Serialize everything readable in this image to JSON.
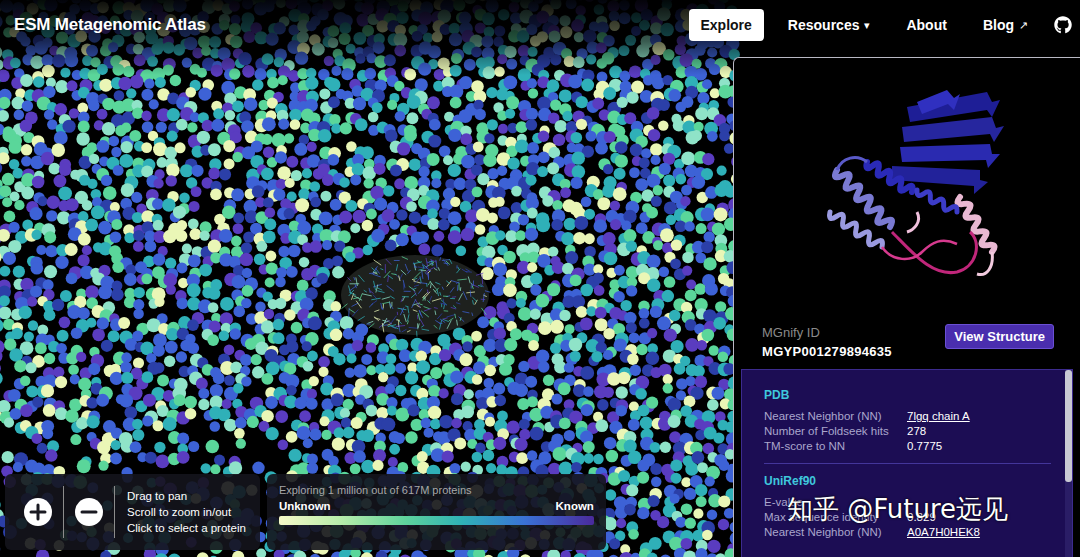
{
  "header": {
    "logo": "ESM Metagenomic Atlas",
    "nav": [
      {
        "label": "Explore",
        "selected": true
      },
      {
        "label": "Resources",
        "selected": false,
        "suffix": "▾"
      },
      {
        "label": "About",
        "selected": false
      },
      {
        "label": "Blog",
        "selected": false,
        "suffix": "↗"
      }
    ]
  },
  "map": {
    "hints": [
      "Drag to pan",
      "Scroll to zoom in/out",
      "Click to select a protein"
    ],
    "caption": "Exploring 1 million out of 617M proteins",
    "legend": {
      "low": "Unknown",
      "high": "Known"
    }
  },
  "protein": {
    "id_label": "MGnify ID",
    "id": "MGYP001279894635",
    "action": "View Structure"
  },
  "sections": [
    {
      "title": "PDB",
      "rows": [
        {
          "label": "Nearest Neighbor (NN)",
          "value": "7lgq chain A",
          "link": true
        },
        {
          "label": "Number of Foldseek hits",
          "value": "278",
          "link": false
        },
        {
          "label": "TM-score to NN",
          "value": "0.7775",
          "link": false
        }
      ]
    },
    {
      "title": "UniRef90",
      "rows": [
        {
          "label": "E-value",
          "link": false
        },
        {
          "label": "Max sequence identity",
          "value": "0.829",
          "link": false
        },
        {
          "label": "Nearest Neighbor (NN)",
          "value": "A0A7H0HEK8",
          "link": true
        }
      ]
    }
  ],
  "scrollbar": {
    "level": 0.6
  },
  "watermark": "知乎 @Future远见"
}
